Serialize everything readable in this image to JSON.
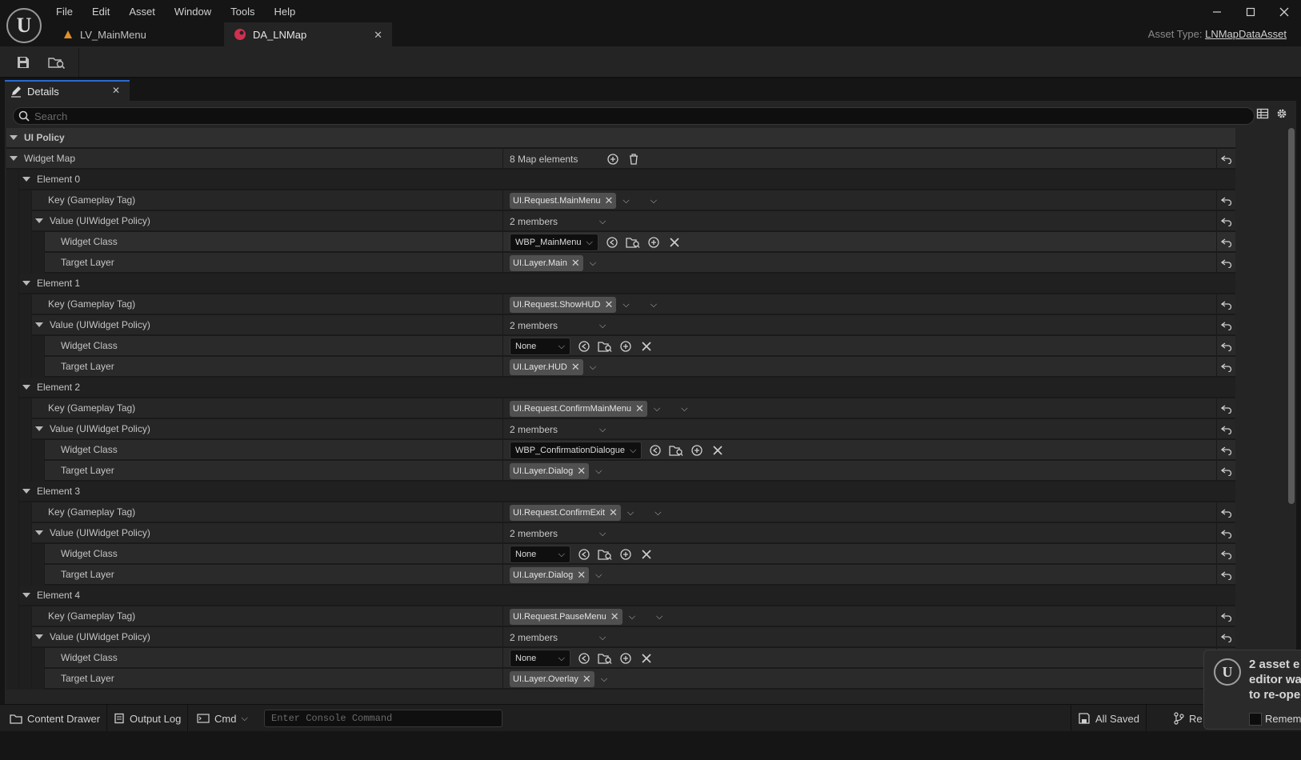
{
  "menu": [
    "File",
    "Edit",
    "Asset",
    "Window",
    "Tools",
    "Help"
  ],
  "tabs": [
    {
      "label": "LV_MainMenu"
    },
    {
      "label": "DA_LNMap"
    }
  ],
  "asset_type": {
    "label": "Asset Type:",
    "value": "LNMapDataAsset"
  },
  "details_tab": {
    "label": "Details"
  },
  "search": {
    "placeholder": "Search"
  },
  "category": "UI Policy",
  "widget_map": {
    "label": "Widget Map",
    "count": "8 Map elements"
  },
  "labels": {
    "key": "Key (Gameplay Tag)",
    "value": "Value (UIWidget Policy)",
    "widget_class": "Widget Class",
    "target_layer": "Target Layer",
    "members": "2 members"
  },
  "elements": [
    {
      "name": "Element 0",
      "key": "UI.Request.MainMenu",
      "widget_class": "WBP_MainMenu",
      "target_layer": "UI.Layer.Main"
    },
    {
      "name": "Element 1",
      "key": "UI.Request.ShowHUD",
      "widget_class": "None",
      "target_layer": "UI.Layer.HUD"
    },
    {
      "name": "Element 2",
      "key": "UI.Request.ConfirmMainMenu",
      "widget_class": "WBP_ConfirmationDialogue",
      "target_layer": "UI.Layer.Dialog"
    },
    {
      "name": "Element 3",
      "key": "UI.Request.ConfirmExit",
      "widget_class": "None",
      "target_layer": "UI.Layer.Dialog"
    },
    {
      "name": "Element 4",
      "key": "UI.Request.PauseMenu",
      "widget_class": "None",
      "target_layer": "UI.Layer.Overlay"
    }
  ],
  "statusbar": {
    "content_drawer": "Content Drawer",
    "output_log": "Output Log",
    "cmd": "Cmd",
    "console_placeholder": "Enter Console Command",
    "saved": "All Saved",
    "revision": "Re"
  },
  "toast": {
    "message_lines": [
      "2 asset e",
      "editor wa",
      "to re-ope"
    ],
    "remember": "Remem"
  },
  "colors": {
    "accent": "#2a6bd2",
    "panel": "#242424",
    "background": "#151515"
  }
}
